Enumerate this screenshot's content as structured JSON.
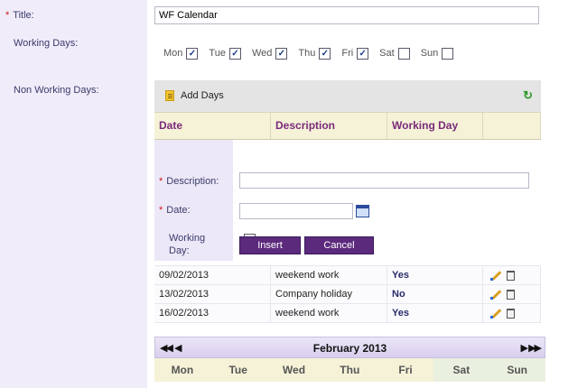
{
  "labels": {
    "title": "Title:",
    "working_days": "Working Days:",
    "non_working_days": "Non Working Days:"
  },
  "title_value": "WF Calendar",
  "working_days": [
    {
      "label": "Mon",
      "checked": true
    },
    {
      "label": "Tue",
      "checked": true
    },
    {
      "label": "Wed",
      "checked": true
    },
    {
      "label": "Thu",
      "checked": true
    },
    {
      "label": "Fri",
      "checked": true
    },
    {
      "label": "Sat",
      "checked": false
    },
    {
      "label": "Sun",
      "checked": false
    }
  ],
  "panel": {
    "add_days": "Add Days",
    "columns": [
      "Date",
      "Description",
      "Working Day"
    ]
  },
  "form": {
    "description_label": "Description:",
    "date_label": "Date:",
    "working_day_label_1": "Working",
    "working_day_label_2": "Day:",
    "insert": "Insert",
    "cancel": "Cancel"
  },
  "rows": [
    {
      "date": "09/02/2013",
      "description": "weekend work",
      "working": "Yes"
    },
    {
      "date": "13/02/2013",
      "description": "Company holiday",
      "working": "No"
    },
    {
      "date": "16/02/2013",
      "description": "weekend work",
      "working": "Yes"
    }
  ],
  "calendar": {
    "month": "February 2013",
    "days": [
      "Mon",
      "Tue",
      "Wed",
      "Thu",
      "Fri",
      "Sat",
      "Sun"
    ]
  },
  "icons": {
    "add": "document-icon",
    "refresh": "refresh-icon",
    "calendar": "calendar-icon",
    "edit": "pencil-icon",
    "delete": "trash-icon"
  }
}
